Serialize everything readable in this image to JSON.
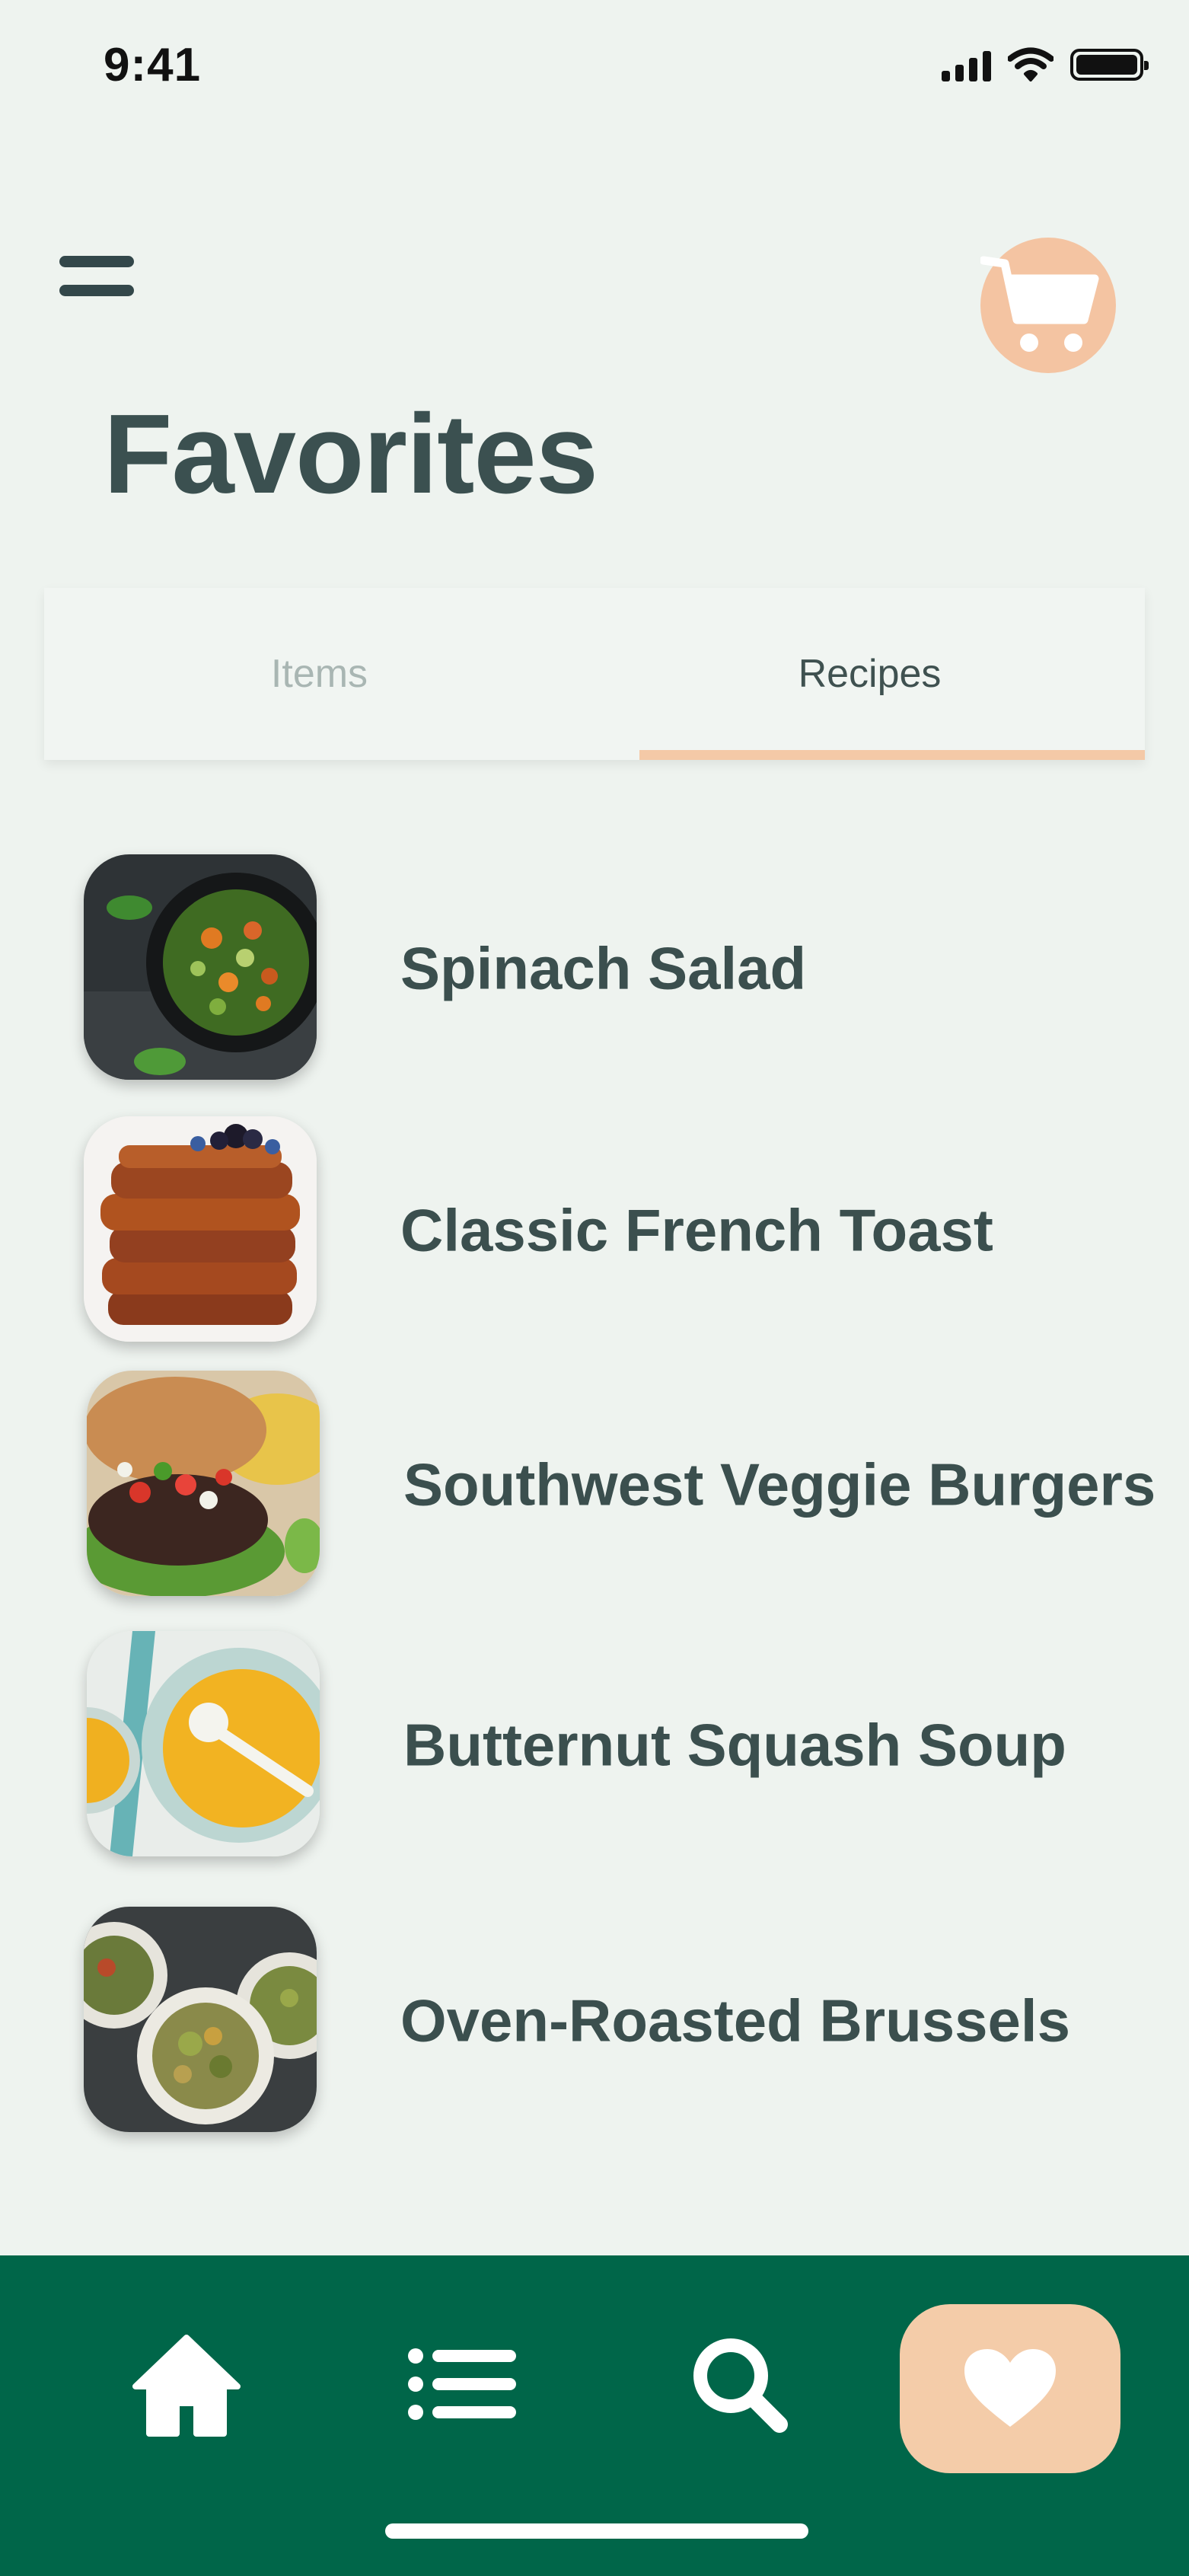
{
  "status_bar": {
    "time": "9:41"
  },
  "header": {
    "title": "Favorites"
  },
  "tabs": [
    {
      "label": "Items",
      "selected": false
    },
    {
      "label": "Recipes",
      "selected": true
    }
  ],
  "recipes": [
    {
      "name": "Spinach Salad"
    },
    {
      "name": "Classic French Toast"
    },
    {
      "name": "Southwest Veggie Burgers"
    },
    {
      "name": "Butternut Squash Soup"
    },
    {
      "name": "Oven-Roasted Brussels"
    }
  ],
  "bottom_nav": {
    "items": [
      {
        "icon": "home-icon",
        "active": false
      },
      {
        "icon": "list-icon",
        "active": false
      },
      {
        "icon": "search-icon",
        "active": false
      },
      {
        "icon": "heart-icon",
        "active": true
      }
    ]
  },
  "colors": {
    "background": "#eef3ef",
    "title": "#3b5050",
    "accent": "#f4c9a7",
    "nav_bg": "#006649"
  }
}
